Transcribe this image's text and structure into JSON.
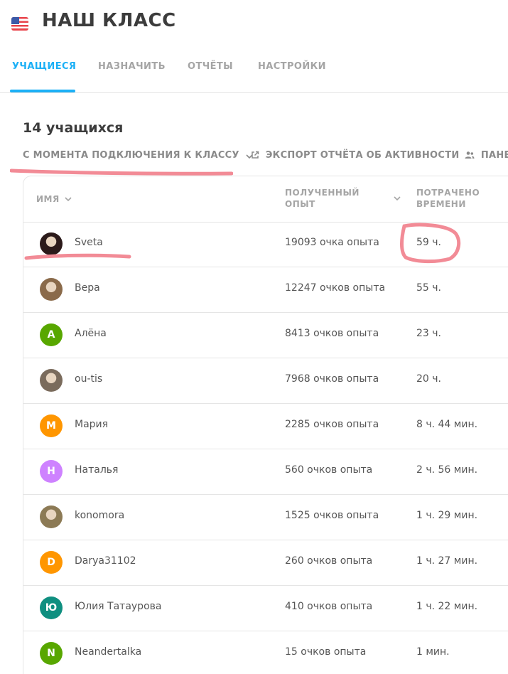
{
  "header": {
    "flag_icon": "us-flag-icon",
    "title": "НАШ КЛАСС"
  },
  "tabs": [
    {
      "label": "УЧАЩИЕСЯ",
      "active": true
    },
    {
      "label": "НАЗНАЧИТЬ",
      "active": false
    },
    {
      "label": "ОТЧЁТЫ",
      "active": false
    },
    {
      "label": "НАСТРОЙКИ",
      "active": false
    }
  ],
  "colors": {
    "accent": "#1cb0f6",
    "annotation": "#f28b96"
  },
  "students_section": {
    "count_label": "14 учащихся",
    "filter_label": "С МОМЕНТА ПОДКЛЮЧЕНИЯ К КЛАССУ",
    "export_label": "ЭКСПОРТ ОТЧЁТА ОБ АКТИВНОСТИ",
    "panel_label": "ПАНЕЛ"
  },
  "table": {
    "columns": {
      "name": "ИМЯ",
      "xp_line1": "ПОЛУЧЕННЫЙ",
      "xp_line2": "ОПЫТ",
      "time_line1": "ПОТРАЧЕНО",
      "time_line2": "ВРЕМЕНИ"
    },
    "rows": [
      {
        "name": "Sveta",
        "xp": "19093 очка опыта",
        "time": "59 ч.",
        "avatar_letter": "",
        "avatar_color": "#2b1a1a",
        "avatar_icon": "photo-avatar"
      },
      {
        "name": "Вера",
        "xp": "12247 очков опыта",
        "time": "55 ч.",
        "avatar_letter": "",
        "avatar_color": "#8a6a4a",
        "avatar_icon": "photo-avatar"
      },
      {
        "name": "Алёна",
        "xp": "8413 очков опыта",
        "time": "23 ч.",
        "avatar_letter": "А",
        "avatar_color": "#58a700"
      },
      {
        "name": "ou-tis",
        "xp": "7968 очков опыта",
        "time": "20 ч.",
        "avatar_letter": "",
        "avatar_color": "#7a6b5c",
        "avatar_icon": "photo-avatar"
      },
      {
        "name": "Мария",
        "xp": "2285 очков опыта",
        "time": "8 ч. 44 мин.",
        "avatar_letter": "М",
        "avatar_color": "#ff9600"
      },
      {
        "name": "Наталья",
        "xp": "560 очков опыта",
        "time": "2 ч. 56 мин.",
        "avatar_letter": "Н",
        "avatar_color": "#ce82ff"
      },
      {
        "name": "konomora",
        "xp": "1525 очков опыта",
        "time": "1 ч. 29 мин.",
        "avatar_letter": "",
        "avatar_color": "#8c7a55",
        "avatar_icon": "photo-avatar"
      },
      {
        "name": "Darya31102",
        "xp": "260 очков опыта",
        "time": "1 ч. 27 мин.",
        "avatar_letter": "D",
        "avatar_color": "#ff9600"
      },
      {
        "name": "Юлия Татаурова",
        "xp": "410 очков опыта",
        "time": "1 ч. 22 мин.",
        "avatar_letter": "Ю",
        "avatar_color": "#0f8f80"
      },
      {
        "name": "Neandertalka",
        "xp": "15 очков опыта",
        "time": "1 мин.",
        "avatar_letter": "N",
        "avatar_color": "#58a700"
      }
    ]
  }
}
